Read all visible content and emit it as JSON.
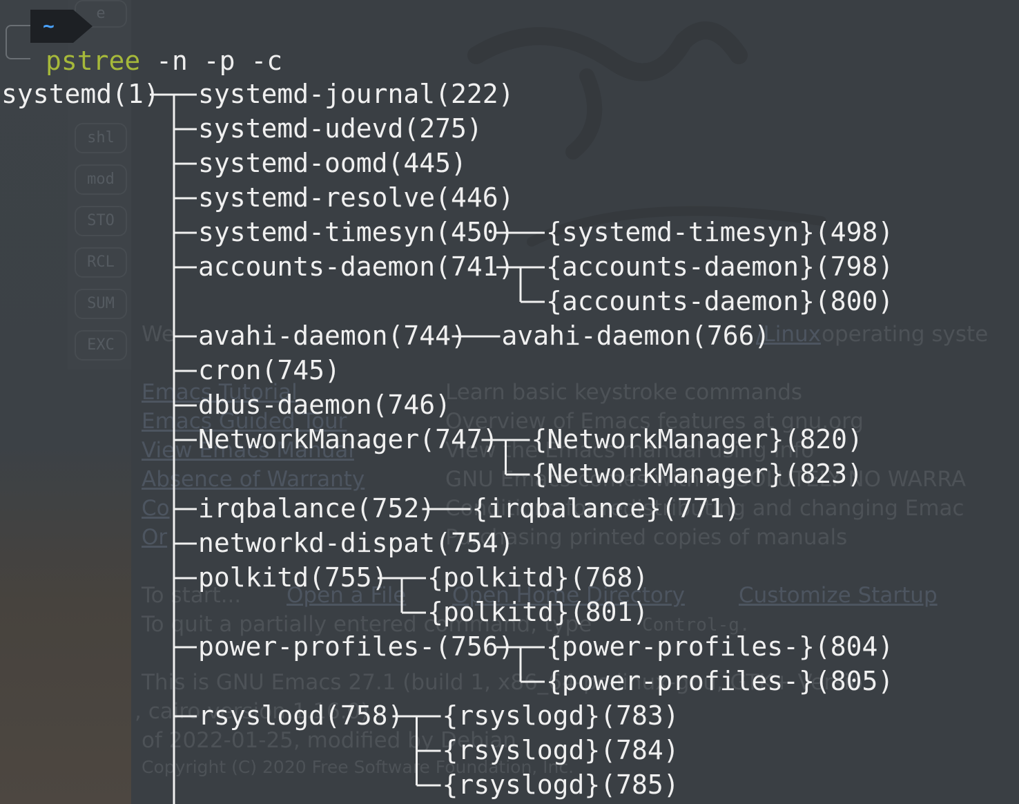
{
  "prompt": {
    "dir": "~"
  },
  "command": {
    "name": "pstree",
    "args": " -n -p -c"
  },
  "background": {
    "panel_buttons": [
      "e",
      "shl",
      "mod",
      "STO",
      "RCL",
      "SUM",
      "EXC"
    ],
    "welcome_line": [
      "We",
      "/Linux",
      " operating syste"
    ],
    "menu_links": [
      "Emacs Tutorial",
      "Emacs Guided Tour",
      "View Emacs Manual",
      "Absence of Warranty",
      "Co",
      "Or"
    ],
    "menu_descs": [
      "Learn basic keystroke commands",
      "Overview of Emacs features at gnu.org",
      "View the Emacs manual using Info",
      "GNU Emacs comes with ABSOLUTELY NO WARRA",
      "Conditions for redistributing and changing Emac",
      "Purchasing printed copies of manuals"
    ],
    "to_start": "To start...",
    "start_links": [
      "Open a File",
      "Open Home Directory",
      "Customize Startup"
    ],
    "quit_text": "To quit a partially entered command, type ",
    "quit_key": "Control-g.",
    "version_1": "This is GNU Emacs 27.1 (build 1, x86_64-pc-linux-gnu, GTK+ Versio",
    "version_2": ", cairo version 1.16.0)",
    "version_3": " of 2022-01-25, modified by Debian",
    "copyright": "Copyright (C) 2020 Free Software Foundation, Inc."
  },
  "tree": {
    "root": "systemd(1)",
    "children": [
      {
        "name": "systemd-journal(222)"
      },
      {
        "name": "systemd-udevd(275)"
      },
      {
        "name": "systemd-oomd(445)"
      },
      {
        "name": "systemd-resolve(446)"
      },
      {
        "name": "systemd-timesyn(450)",
        "threads": [
          "{systemd-timesyn}(498)"
        ]
      },
      {
        "name": "accounts-daemon(741)",
        "threads": [
          "{accounts-daemon}(798)",
          "{accounts-daemon}(800)"
        ]
      },
      {
        "name": "avahi-daemon(744)",
        "threads": [
          "avahi-daemon(766)"
        ]
      },
      {
        "name": "cron(745)"
      },
      {
        "name": "dbus-daemon(746)"
      },
      {
        "name": "NetworkManager(747)",
        "threads": [
          "{NetworkManager}(820)",
          "{NetworkManager}(823)"
        ]
      },
      {
        "name": "irqbalance(752)",
        "threads": [
          "{irqbalance}(771)"
        ]
      },
      {
        "name": "networkd-dispat(754)"
      },
      {
        "name": "polkitd(755)",
        "threads": [
          "{polkitd}(768)",
          "{polkitd}(801)"
        ]
      },
      {
        "name": "power-profiles-(756)",
        "threads": [
          "{power-profiles-}(804)",
          "{power-profiles-}(805)"
        ]
      },
      {
        "name": "rsyslogd(758)",
        "threads": [
          "{rsyslogd}(783)",
          "{rsyslogd}(784)",
          "{rsyslogd}(785)"
        ]
      }
    ]
  },
  "colors": {
    "background": "#3a3f44",
    "text": "#f0f0f0",
    "command": "#a6b93a",
    "prompt_dir": "#4aa3ff"
  }
}
